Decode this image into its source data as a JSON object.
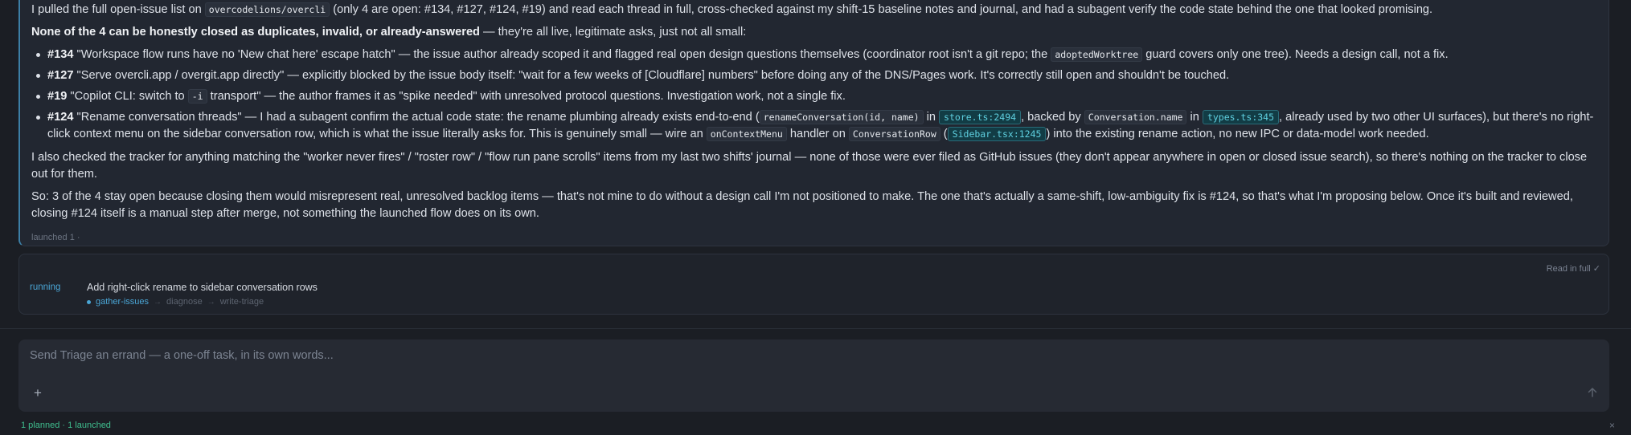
{
  "message": {
    "p1_a": "I pulled the full open-issue list on ",
    "p1_code": "overcodelions/overcli",
    "p1_b": " (only 4 are open: #134, #127, #124, #19) and read each thread in full, cross-checked against my shift-15 baseline notes and journal, and had a subagent verify the code state behind the one that looked promising.",
    "p2_lead": "None of the 4 can be honestly closed as duplicates, invalid, or already-answered",
    "p2_rest": " — they're all live, legitimate asks, just not all small:",
    "items": [
      {
        "num": "#134",
        "a": " \"Workspace flow runs have no 'New chat here' escape hatch\" — the issue author already scoped it and flagged real open design questions themselves (coordinator root isn't a git repo; the ",
        "code": "adoptedWorktree",
        "b": " guard covers only one tree). Needs a design call, not a fix."
      },
      {
        "num": "#127",
        "a": " \"Serve overcli.app / overgit.app directly\" — explicitly blocked by the issue body itself: \"wait for a few weeks of [Cloudflare] numbers\" before doing any of the DNS/Pages work. It's correctly still open and shouldn't be touched."
      },
      {
        "num": "#19",
        "a": " \"Copilot CLI: switch to ",
        "code": "-i",
        "b": " transport\" — the author frames it as \"spike needed\" with unresolved protocol questions. Investigation work, not a single fix."
      },
      {
        "num": "#124",
        "a": " \"Rename conversation threads\" — I had a subagent confirm the actual code state: the rename plumbing already exists end-to-end (",
        "code1": "renameConversation(id, name)",
        "b": " in ",
        "ref1": "store.ts:2494",
        "c": ", backed by ",
        "code2": "Conversation.name",
        "d": " in ",
        "ref2": "types.ts:345",
        "e": ", already used by two other UI surfaces), but there's no right-click context menu on the sidebar conversation row, which is what the issue literally asks for. This is genuinely small — wire an ",
        "code3": "onContextMenu",
        "f": " handler on ",
        "code4": "ConversationRow",
        "g": " (",
        "ref3": "Sidebar.tsx:1245",
        "h": ") into the existing rename action, no new IPC or data-model work needed."
      }
    ],
    "p3": "I also checked the tracker for anything matching the \"worker never fires\" / \"roster row\" / \"flow run pane scrolls\" items from my last two shifts' journal — none of those were ever filed as GitHub issues (they don't appear anywhere in open or closed issue search), so there's nothing on the tracker to close out for them.",
    "p4": "So: 3 of the 4 stay open because closing them would misrepresent real, unresolved backlog items — that's not mine to do without a design call I'm not positioned to make. The one that's actually a same-shift, low-ambiguity fix is #124, so that's what I'm proposing below. Once it's built and reviewed, closing #124 itself is a manual step after merge, not something the launched flow does on its own.",
    "launched_note": "launched 1 ·"
  },
  "run": {
    "read_full": "Read in full ✓",
    "status": "running",
    "title": "Add right-click rename to sidebar conversation rows",
    "steps": [
      "gather-issues",
      "diagnose",
      "write-triage"
    ],
    "arrow": "→"
  },
  "composer": {
    "placeholder": "Send Triage an errand — a one-off task, in its own words...",
    "add_glyph": "+"
  },
  "footer": {
    "status": "1 planned · 1 launched",
    "close_glyph": "×"
  },
  "colors": {
    "accent": "#4aa6d6",
    "code_ref_bg": "#123c45",
    "code_ref_fg": "#5fd0e0",
    "footer_green": "#3fbf8f",
    "background": "#1b1e24"
  },
  "icons": {
    "add": "plus-icon",
    "send": "arrow-up-icon",
    "close": "close-icon",
    "read_check": "check-icon",
    "step_active": "dot-icon"
  }
}
